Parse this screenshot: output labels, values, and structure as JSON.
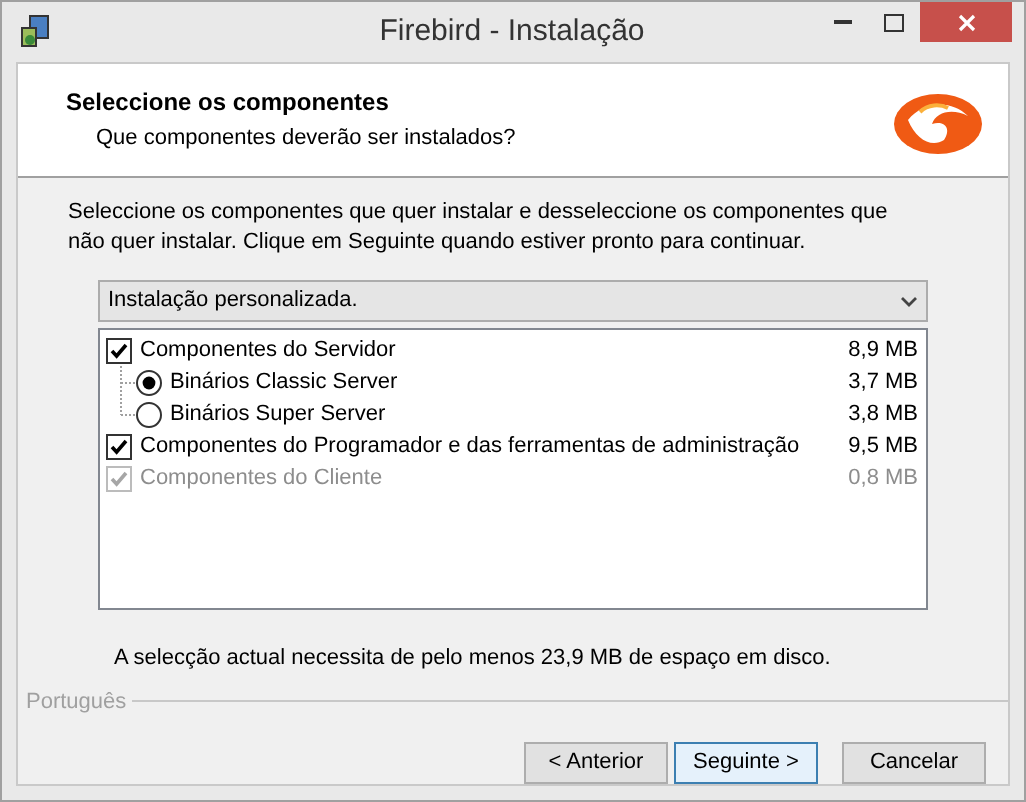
{
  "window": {
    "title": "Firebird - Instalação"
  },
  "header": {
    "title": "Seleccione os componentes",
    "subtitle": "Que componentes deverão ser instalados?"
  },
  "instructions": "Seleccione os componentes que quer instalar e desseleccione os componentes que não quer instalar. Clique em Seguinte quando estiver pronto para continuar.",
  "setup_type": {
    "value": "Instalação personalizada."
  },
  "components": [
    {
      "kind": "checkbox",
      "label": "Componentes do Servidor",
      "size": "8,9 MB",
      "checked": true,
      "disabled": false,
      "children": [
        {
          "kind": "radio",
          "label": "Binários Classic Server",
          "size": "3,7 MB",
          "selected": true,
          "disabled": false
        },
        {
          "kind": "radio",
          "label": "Binários Super Server",
          "size": "3,8 MB",
          "selected": false,
          "disabled": false
        }
      ]
    },
    {
      "kind": "checkbox",
      "label": "Componentes do Programador e das ferramentas de administração",
      "size": "9,5 MB",
      "checked": true,
      "disabled": false
    },
    {
      "kind": "checkbox",
      "label": "Componentes do Cliente",
      "size": "0,8 MB",
      "checked": true,
      "disabled": true
    }
  ],
  "disk_space": "A selecção actual necessita de pelo menos 23,9 MB de espaço em disco.",
  "language": "Português",
  "buttons": [
    {
      "label": "< Anterior",
      "default": false
    },
    {
      "label": "Seguinte >",
      "default": true
    },
    {
      "label": "Cancelar",
      "default": false
    }
  ]
}
